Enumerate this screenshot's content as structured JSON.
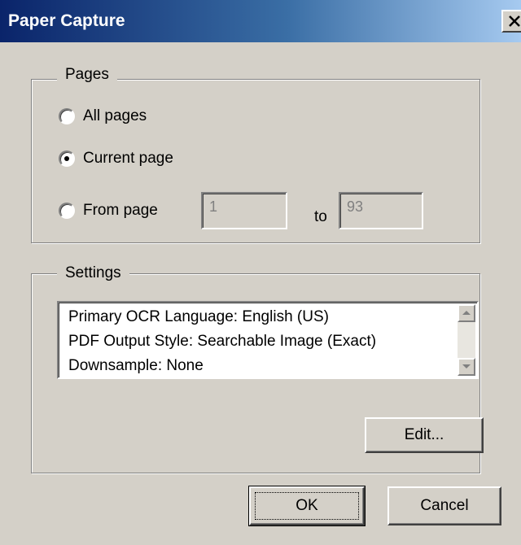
{
  "window": {
    "title": "Paper Capture",
    "close_icon": "close-icon"
  },
  "pages": {
    "legend": "Pages",
    "options": [
      {
        "label": "All pages",
        "checked": false
      },
      {
        "label": "Current page",
        "checked": true
      },
      {
        "label": "From page",
        "checked": false
      }
    ],
    "from_value": "1",
    "to_label": "to",
    "to_value": "93"
  },
  "settings": {
    "legend": "Settings",
    "lines": [
      "Primary OCR Language: English (US)",
      "PDF Output Style: Searchable Image (Exact)",
      "Downsample: None"
    ],
    "edit_label": "Edit..."
  },
  "footer": {
    "ok_label": "OK",
    "cancel_label": "Cancel"
  }
}
